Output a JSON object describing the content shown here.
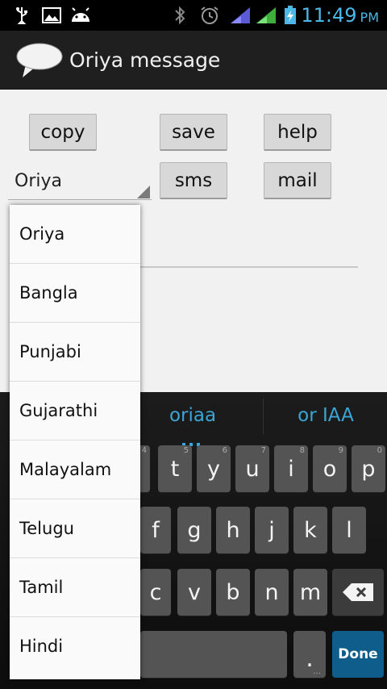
{
  "status_bar": {
    "time": "11:49",
    "ampm": "PM"
  },
  "app": {
    "title": "Oriya message"
  },
  "buttons": {
    "copy": "copy",
    "save": "save",
    "help": "help",
    "sms": "sms",
    "mail": "mail"
  },
  "spinner": {
    "selected": "Oriya"
  },
  "dropdown": {
    "options": [
      "Oriya",
      "Bangla",
      "Punjabi",
      "Gujarathi",
      "Malayalam",
      "Telugu",
      "Tamil",
      "Hindi"
    ]
  },
  "keyboard": {
    "suggestions": [
      "oriaa",
      "or IAA"
    ],
    "row1": [
      {
        "k": "t",
        "h": "5"
      },
      {
        "k": "y",
        "h": "6"
      },
      {
        "k": "u",
        "h": "7"
      },
      {
        "k": "i",
        "h": "8"
      },
      {
        "k": "o",
        "h": "9"
      },
      {
        "k": "p",
        "h": "0"
      }
    ],
    "row1_hint_partial": "4",
    "row2": [
      "f",
      "g",
      "h",
      "j",
      "k",
      "l"
    ],
    "row3": [
      "c",
      "v",
      "b",
      "n",
      "m"
    ],
    "period": ".",
    "period_hint": "…",
    "done": "Done"
  },
  "colors": {
    "accent": "#3aa6d6",
    "done_key": "#0f5d8a",
    "action_bar": "#1f1f1f",
    "content_bg": "#f1f1f1"
  }
}
